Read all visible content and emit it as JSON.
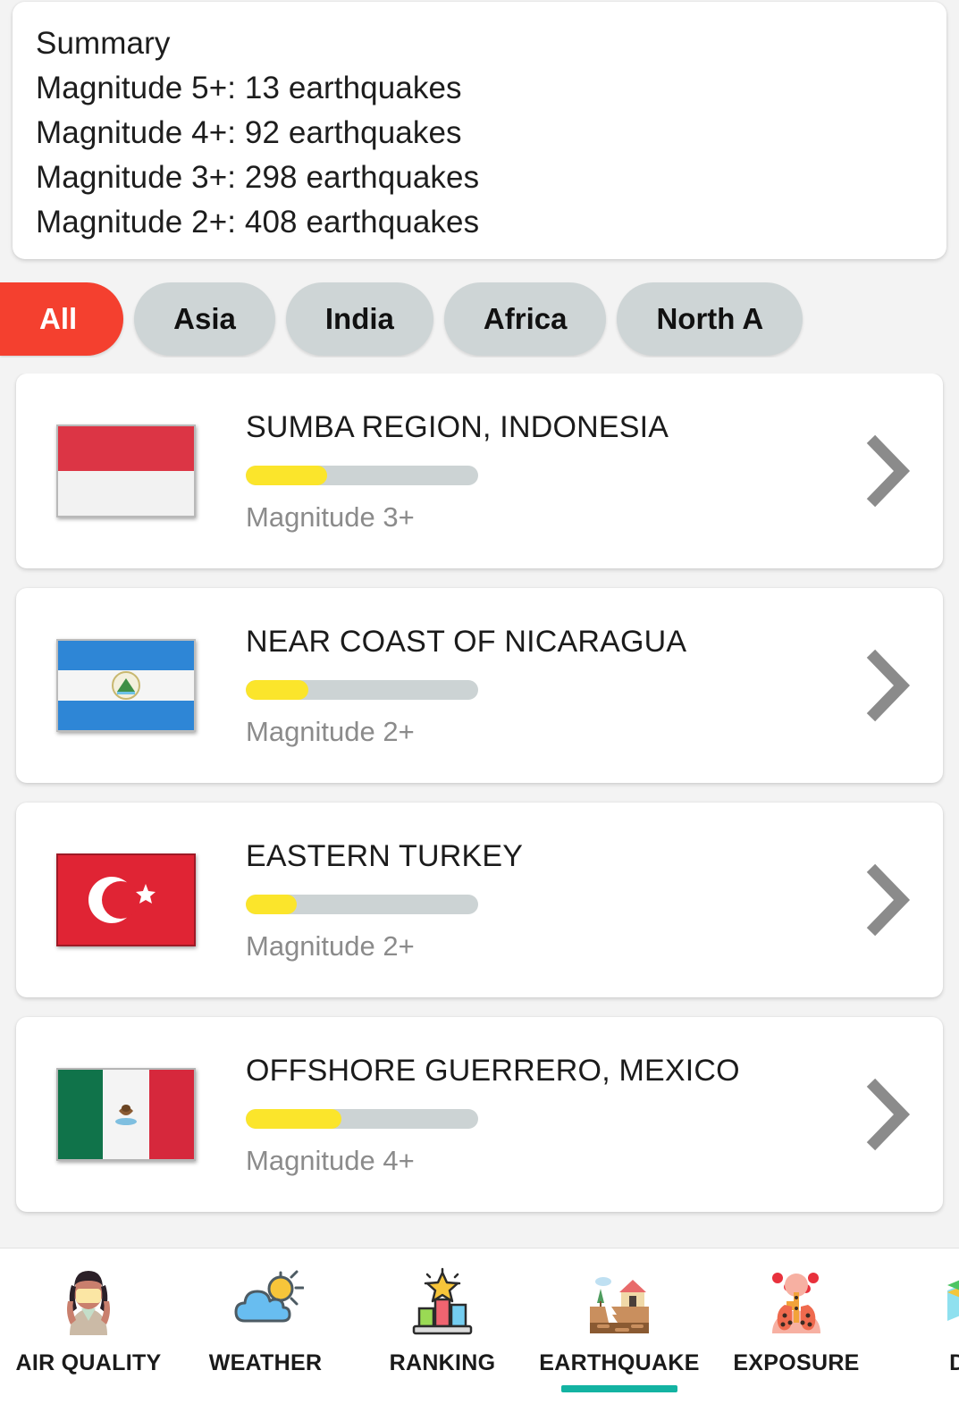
{
  "summary": {
    "title": "Summary",
    "lines": [
      "Summary",
      "Magnitude 5+: 13 earthquakes",
      "Magnitude 4+: 92 earthquakes",
      "Magnitude 3+: 298 earthquakes",
      "Magnitude 2+: 408 earthquakes"
    ],
    "counts": {
      "magnitude_5_plus": 13,
      "magnitude_4_plus": 92,
      "magnitude_3_plus": 298,
      "magnitude_2_plus": 408
    }
  },
  "filters": {
    "selected": "All",
    "selected_color": "#f4402f",
    "inactive_color": "#ced5d6",
    "tabs": [
      {
        "label": "All",
        "selected": true
      },
      {
        "label": "Asia",
        "selected": false
      },
      {
        "label": "India",
        "selected": false
      },
      {
        "label": "Africa",
        "selected": false
      },
      {
        "label": "North A",
        "selected": false
      }
    ]
  },
  "list": {
    "items": [
      {
        "title": "SUMBA REGION, INDONESIA",
        "magnitude": "Magnitude 3+",
        "progress_percent": 35,
        "flag": "flag-indonesia",
        "chevron": "chevron-right-icon"
      },
      {
        "title": "NEAR COAST OF NICARAGUA",
        "magnitude": "Magnitude 2+",
        "progress_percent": 27,
        "flag": "flag-nicaragua",
        "chevron": "chevron-right-icon"
      },
      {
        "title": "EASTERN TURKEY",
        "magnitude": "Magnitude 2+",
        "progress_percent": 22,
        "flag": "flag-turkey",
        "chevron": "chevron-right-icon"
      },
      {
        "title": "OFFSHORE GUERRERO, MEXICO",
        "magnitude": "Magnitude 4+",
        "progress_percent": 41,
        "flag": "flag-mexico",
        "chevron": "chevron-right-icon"
      }
    ],
    "bar_fill_color": "#fbe52b",
    "bar_track_color": "#ccd3d4"
  },
  "bottom_nav": {
    "active": "EARTHQUAKE",
    "active_indicator_color": "#13b3a2",
    "items": [
      {
        "label": "AIR QUALITY",
        "icon": "person-mask-icon",
        "active": false
      },
      {
        "label": "WEATHER",
        "icon": "sun-behind-cloud-icon",
        "active": false
      },
      {
        "label": "RANKING",
        "icon": "bar-chart-star-icon",
        "active": false
      },
      {
        "label": "EARTHQUAKE",
        "icon": "earthquake-house-icon",
        "active": true
      },
      {
        "label": "EXPOSURE",
        "icon": "lungs-icon",
        "active": false
      },
      {
        "label": "DUS",
        "icon": "dust-map-icon",
        "active": false
      }
    ]
  }
}
